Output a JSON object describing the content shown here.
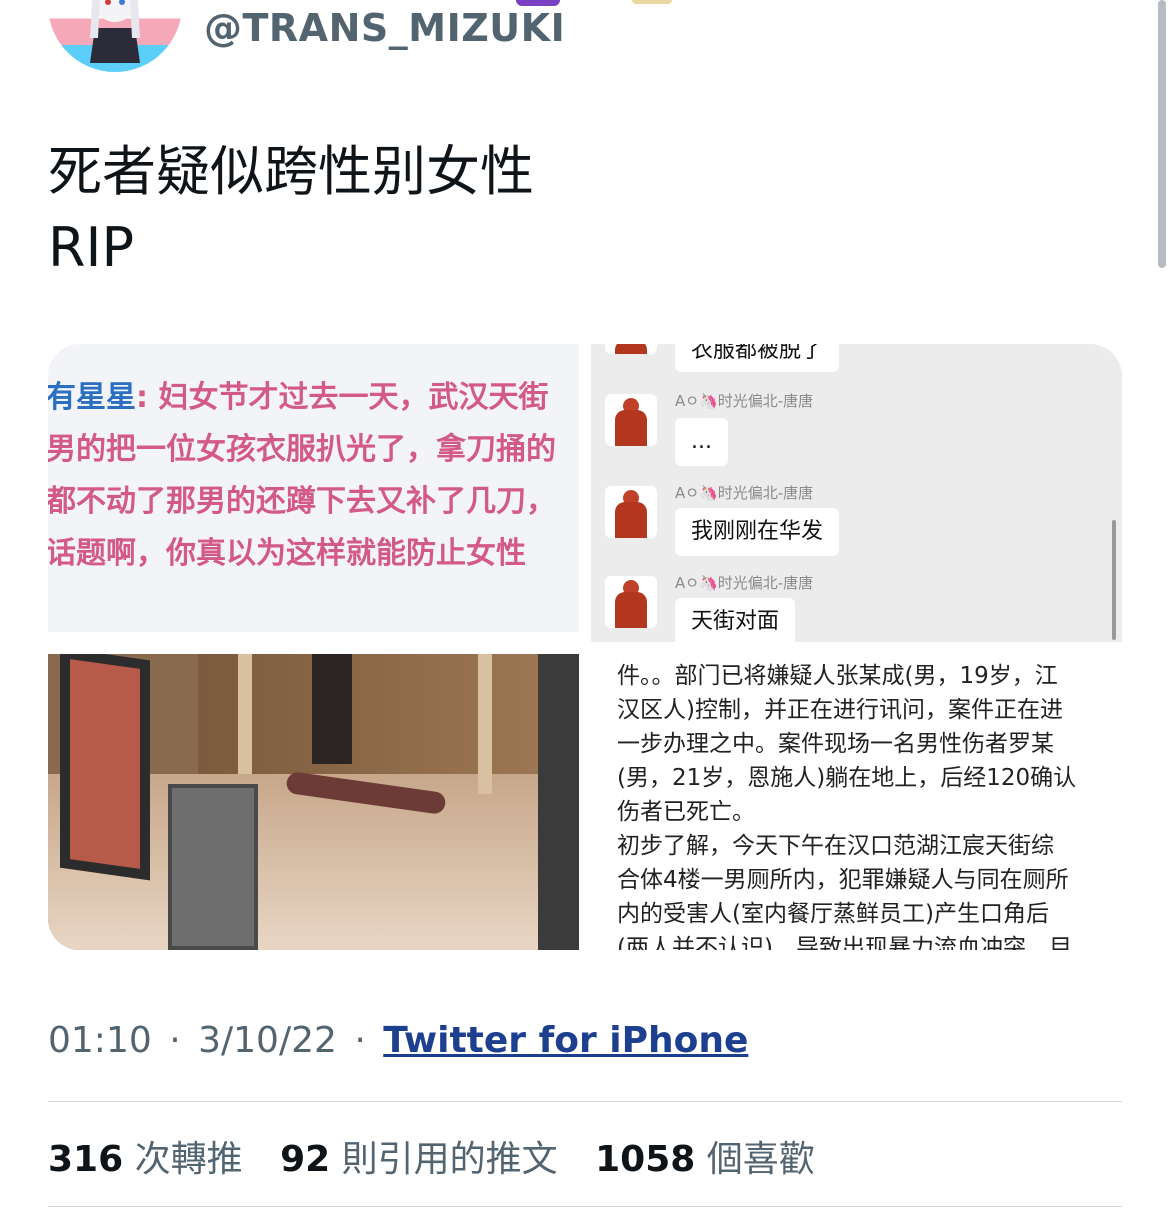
{
  "header": {
    "handle": "@TRANS_MIZUKI"
  },
  "tweet": {
    "line1": "死者疑似跨性别女性",
    "line2": "RIP"
  },
  "media": {
    "pink_text": {
      "lines": [
        {
          "name": "有星星",
          "text": ": 妇女节才过去一天，武汉天街"
        },
        {
          "name": "",
          "text": "男的把一位女孩衣服扒光了，拿刀捅的"
        },
        {
          "name": "",
          "text": "都不动了那男的还蹲下去又补了几刀，"
        },
        {
          "name": "",
          "text": "话题啊，你真以为这样就能防止女性"
        }
      ]
    },
    "chat": {
      "top_bubble": "衣服都被脱了",
      "sender": "Aㅇ🦄时光偏北-唐唐",
      "messages": [
        "...",
        "我刚刚在华发",
        "天街对面"
      ]
    },
    "news": {
      "lines": [
        "件。。部门已将嫌疑人张某成(男，19岁，江",
        "汉区人)控制，并正在进行讯问，案件正在进",
        "一步办理之中。案件现场一名男性伤者罗某",
        "(男，21岁，恩施人)躺在地上，后经120确认",
        "伤者已死亡。",
        "初步了解，今天下午在汉口范湖江宸天街综",
        "合体4楼一男厕所内，犯罪嫌疑人与同在厕所",
        "内的受害人(室内餐厅蒸鲜员工)产生口角后",
        "(两人并不认识)，导致出现暴力流血冲突。目"
      ]
    }
  },
  "meta": {
    "time": "01:10",
    "date": "3/10/22",
    "separator": "·",
    "source": "Twitter for iPhone"
  },
  "stats": {
    "retweets_count": "316",
    "retweets_label": "次轉推",
    "quotes_count": "92",
    "quotes_label": "則引用的推文",
    "likes_count": "1058",
    "likes_label": "個喜歡"
  },
  "colors": {
    "secondary_text": "#536471",
    "link": "#1d3f8f",
    "pink_text": "#d45a86",
    "divider": "#cfd9de"
  }
}
